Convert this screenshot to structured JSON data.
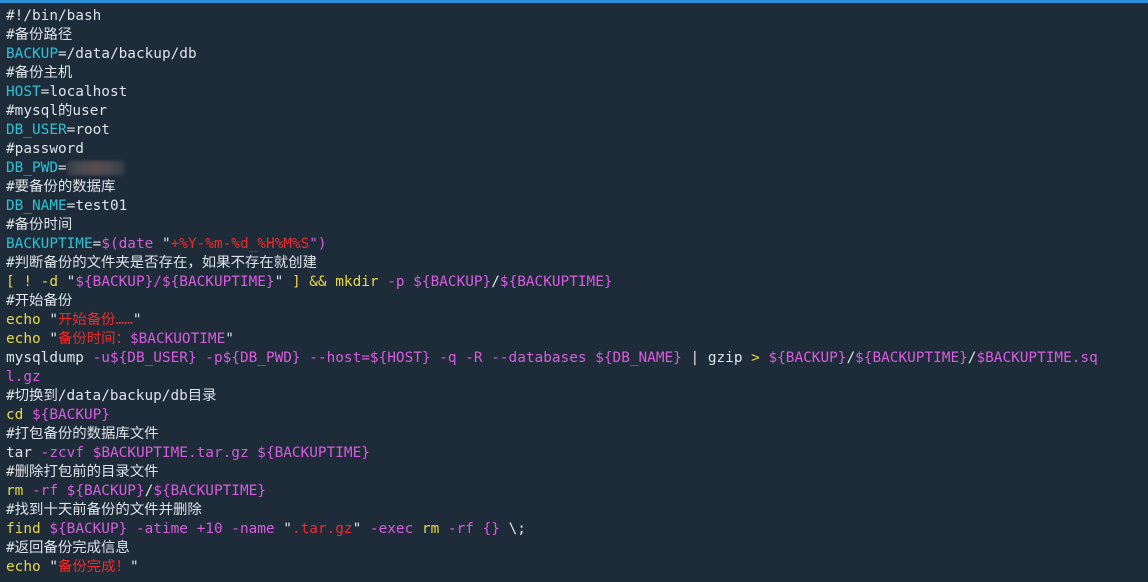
{
  "colors": {
    "background": "#1e2b38",
    "top_border": "#2a8fd6",
    "comment": "#dce3ea",
    "variable": "#2fc1d6",
    "command": "#e6d84a",
    "option": "#d85ce0",
    "string": "#ee2a2a",
    "plain": "#dce3ea"
  },
  "lines": [
    [
      {
        "t": "#!/bin/bash",
        "c": "comment"
      }
    ],
    [
      {
        "t": "#备份路径",
        "c": "comment"
      }
    ],
    [
      {
        "t": "BACKUP",
        "c": "var"
      },
      {
        "t": "=/data/backup/db",
        "c": "txt"
      }
    ],
    [
      {
        "t": "#备份主机",
        "c": "comment"
      }
    ],
    [
      {
        "t": "HOST",
        "c": "var"
      },
      {
        "t": "=localhost",
        "c": "txt"
      }
    ],
    [
      {
        "t": "#mysql的user",
        "c": "comment"
      }
    ],
    [
      {
        "t": "DB_USER",
        "c": "var"
      },
      {
        "t": "=root",
        "c": "txt"
      }
    ],
    [
      {
        "t": "#password",
        "c": "comment"
      }
    ],
    [
      {
        "t": "DB_PWD",
        "c": "var"
      },
      {
        "t": "=",
        "c": "txt"
      },
      {
        "t": "",
        "c": "masked"
      }
    ],
    [
      {
        "t": "#要备份的数据库",
        "c": "comment"
      }
    ],
    [
      {
        "t": "DB_NAME",
        "c": "var"
      },
      {
        "t": "=test01",
        "c": "txt"
      }
    ],
    [
      {
        "t": "#备份时间",
        "c": "comment"
      }
    ],
    [
      {
        "t": "BACKUPTIME",
        "c": "var"
      },
      {
        "t": "=",
        "c": "txt"
      },
      {
        "t": "$(date ",
        "c": "opt"
      },
      {
        "t": "\"",
        "c": "punct"
      },
      {
        "t": "+%Y-%m-%d_%H%M%S",
        "c": "str"
      },
      {
        "t": "\")",
        "c": "opt"
      }
    ],
    [
      {
        "t": "#判断备份的文件夹是否存在，如果不存在就创建",
        "c": "comment"
      }
    ],
    [
      {
        "t": "[ ! -d ",
        "c": "cmd"
      },
      {
        "t": "\"",
        "c": "punct"
      },
      {
        "t": "${BACKUP}/${BACKUPTIME}",
        "c": "opt"
      },
      {
        "t": "\"",
        "c": "punct"
      },
      {
        "t": " ] && ",
        "c": "cmd"
      },
      {
        "t": "mkdir",
        "c": "cmd"
      },
      {
        "t": " -p ",
        "c": "opt"
      },
      {
        "t": "${BACKUP}",
        "c": "opt"
      },
      {
        "t": "/",
        "c": "txt"
      },
      {
        "t": "${BACKUPTIME}",
        "c": "opt"
      }
    ],
    [
      {
        "t": "#开始备份",
        "c": "comment"
      }
    ],
    [
      {
        "t": "echo",
        "c": "cmd"
      },
      {
        "t": " \"",
        "c": "punct"
      },
      {
        "t": "开始备份……",
        "c": "str"
      },
      {
        "t": "\"",
        "c": "punct"
      }
    ],
    [
      {
        "t": "echo",
        "c": "cmd"
      },
      {
        "t": " \"",
        "c": "punct"
      },
      {
        "t": "备份时间：",
        "c": "str"
      },
      {
        "t": "$BACKUOTIME",
        "c": "opt"
      },
      {
        "t": "\"",
        "c": "punct"
      }
    ],
    [
      {
        "t": "mysqldump",
        "c": "txt"
      },
      {
        "t": " -u",
        "c": "opt"
      },
      {
        "t": "${DB_USER}",
        "c": "opt"
      },
      {
        "t": " -p",
        "c": "opt"
      },
      {
        "t": "${DB_PWD}",
        "c": "opt"
      },
      {
        "t": " --host=",
        "c": "opt"
      },
      {
        "t": "${HOST}",
        "c": "opt"
      },
      {
        "t": " -q -R --databases ",
        "c": "opt"
      },
      {
        "t": "${DB_NAME}",
        "c": "opt"
      },
      {
        "t": " | gzip ",
        "c": "txt"
      },
      {
        "t": "> ",
        "c": "cmd"
      },
      {
        "t": "${BACKUP}",
        "c": "opt"
      },
      {
        "t": "/",
        "c": "txt"
      },
      {
        "t": "${BACKUPTIME}",
        "c": "opt"
      },
      {
        "t": "/",
        "c": "txt"
      },
      {
        "t": "$BACKUPTIME.sq",
        "c": "opt"
      }
    ],
    [
      {
        "t": "l.gz",
        "c": "opt"
      }
    ],
    [
      {
        "t": "#切换到/data/backup/db目录",
        "c": "comment"
      }
    ],
    [
      {
        "t": "cd",
        "c": "cmd"
      },
      {
        "t": " ",
        "c": "txt"
      },
      {
        "t": "${BACKUP}",
        "c": "opt"
      }
    ],
    [
      {
        "t": "#打包备份的数据库文件",
        "c": "comment"
      }
    ],
    [
      {
        "t": "tar",
        "c": "txt"
      },
      {
        "t": " -zcvf ",
        "c": "opt"
      },
      {
        "t": "$BACKUPTIME.tar.gz ",
        "c": "opt"
      },
      {
        "t": "${BACKUPTIME}",
        "c": "opt"
      }
    ],
    [
      {
        "t": "#删除打包前的目录文件",
        "c": "comment"
      }
    ],
    [
      {
        "t": "rm",
        "c": "cmd"
      },
      {
        "t": " -rf ",
        "c": "opt"
      },
      {
        "t": "${BACKUP}",
        "c": "opt"
      },
      {
        "t": "/",
        "c": "txt"
      },
      {
        "t": "${BACKUPTIME}",
        "c": "opt"
      }
    ],
    [
      {
        "t": "#找到十天前备份的文件并删除",
        "c": "comment"
      }
    ],
    [
      {
        "t": "find",
        "c": "cmd"
      },
      {
        "t": " ",
        "c": "txt"
      },
      {
        "t": "${BACKUP}",
        "c": "opt"
      },
      {
        "t": " -atime +10 -name ",
        "c": "opt"
      },
      {
        "t": "\"",
        "c": "punct"
      },
      {
        "t": ".tar.gz",
        "c": "str"
      },
      {
        "t": "\"",
        "c": "punct"
      },
      {
        "t": " -exec ",
        "c": "opt"
      },
      {
        "t": "rm",
        "c": "cmd"
      },
      {
        "t": " -rf ",
        "c": "opt"
      },
      {
        "t": "{}",
        "c": "opt"
      },
      {
        "t": " \\;",
        "c": "txt"
      }
    ],
    [
      {
        "t": "#返回备份完成信息",
        "c": "comment"
      }
    ],
    [
      {
        "t": "echo",
        "c": "cmd"
      },
      {
        "t": " \"",
        "c": "punct"
      },
      {
        "t": "备份完成！",
        "c": "str"
      },
      {
        "t": "\"",
        "c": "punct"
      }
    ]
  ]
}
